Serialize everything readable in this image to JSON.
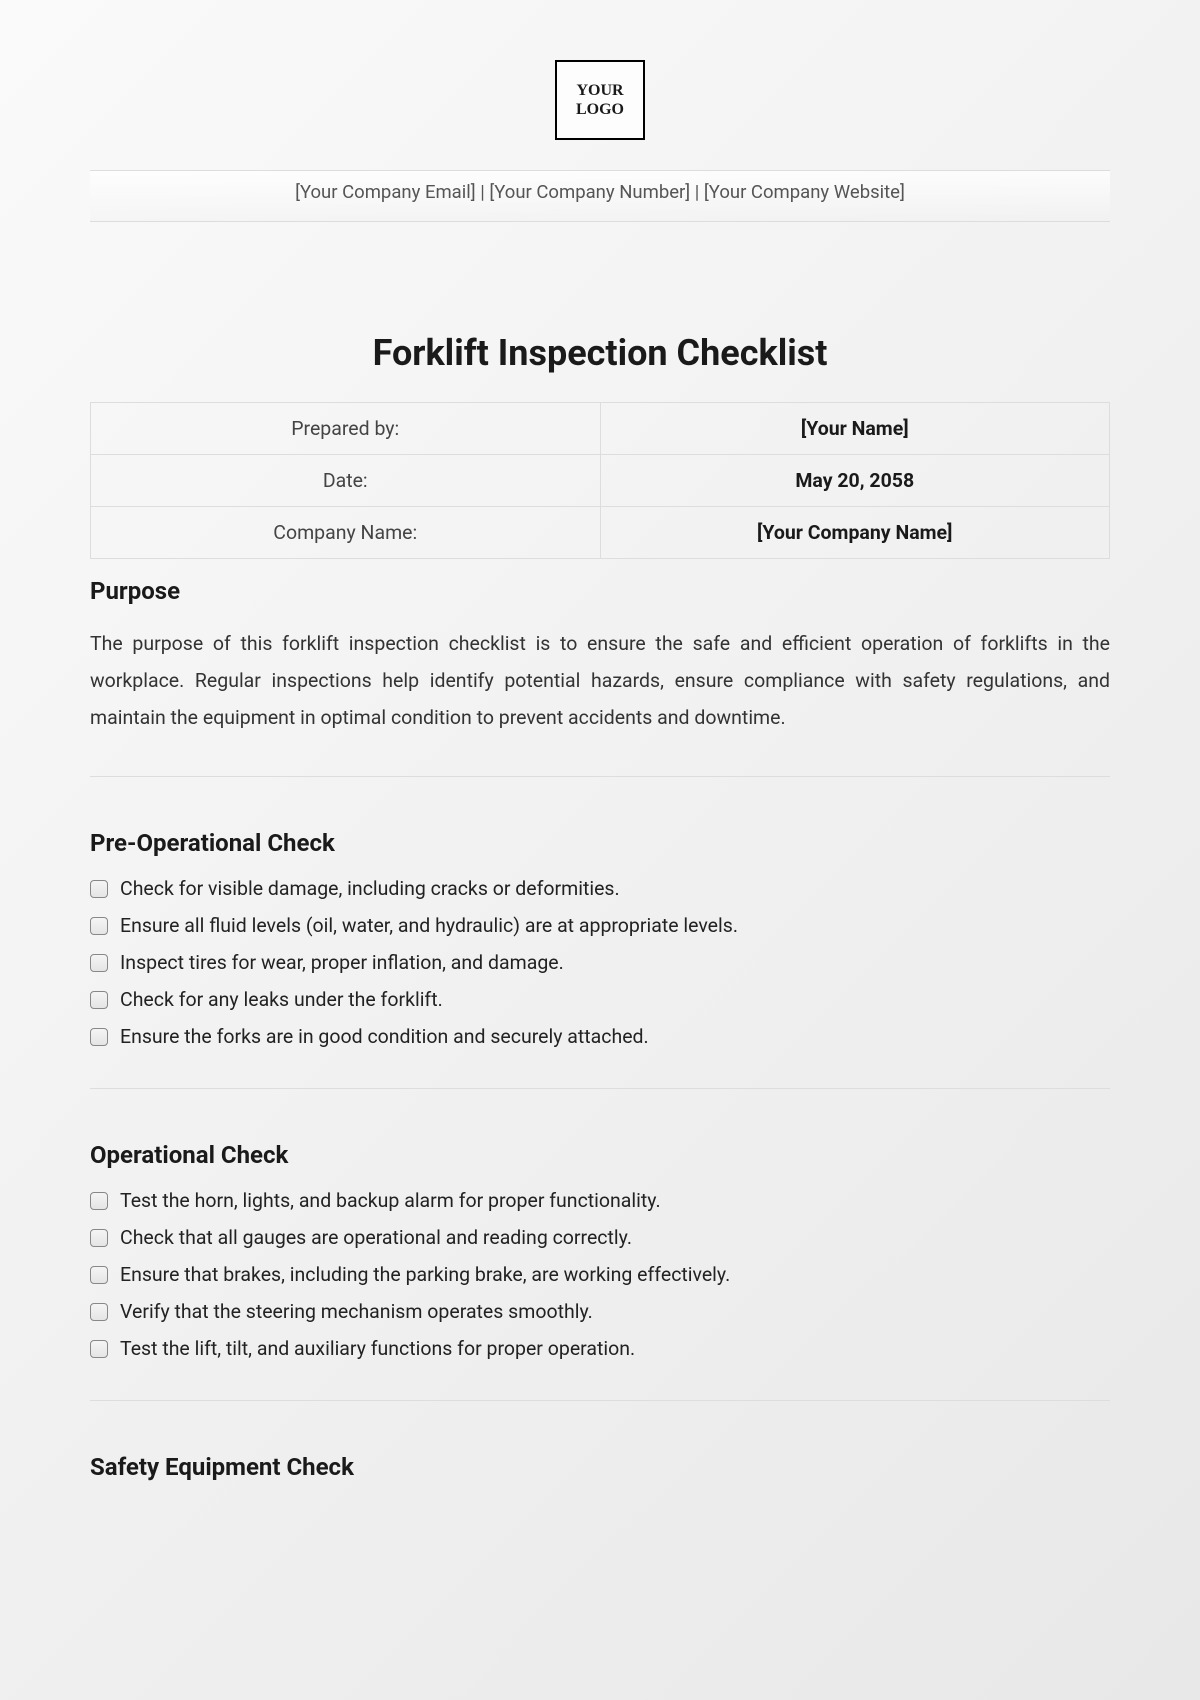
{
  "logo_text": "YOUR LOGO",
  "contact_line": "[Your Company Email] | [Your Company Number] | [Your Company Website]",
  "title": "Forklift Inspection Checklist",
  "info_rows": [
    {
      "label": "Prepared by:",
      "value": "[Your Name]"
    },
    {
      "label": "Date:",
      "value": "May 20, 2058"
    },
    {
      "label": "Company Name:",
      "value": "[Your Company Name]"
    }
  ],
  "purpose_heading": "Purpose",
  "purpose_text": "The purpose of this forklift inspection checklist is to ensure the safe and efficient operation of forklifts in the workplace. Regular inspections help identify potential hazards, ensure compliance with safety regulations, and maintain the equipment in optimal condition to prevent accidents and downtime.",
  "sections": [
    {
      "heading": "Pre-Operational Check",
      "items": [
        "Check for visible damage, including cracks or deformities.",
        "Ensure all fluid levels (oil, water, and hydraulic) are at appropriate levels.",
        "Inspect tires for wear, proper inflation, and damage.",
        "Check for any leaks under the forklift.",
        "Ensure the forks are in good condition and securely attached."
      ]
    },
    {
      "heading": "Operational Check",
      "items": [
        "Test the horn, lights, and backup alarm for proper functionality.",
        "Check that all gauges are operational and reading correctly.",
        "Ensure that brakes, including the parking brake, are working effectively.",
        "Verify that the steering mechanism operates smoothly.",
        "Test the lift, tilt, and auxiliary functions for proper operation."
      ]
    },
    {
      "heading": "Safety Equipment Check",
      "items": []
    }
  ]
}
